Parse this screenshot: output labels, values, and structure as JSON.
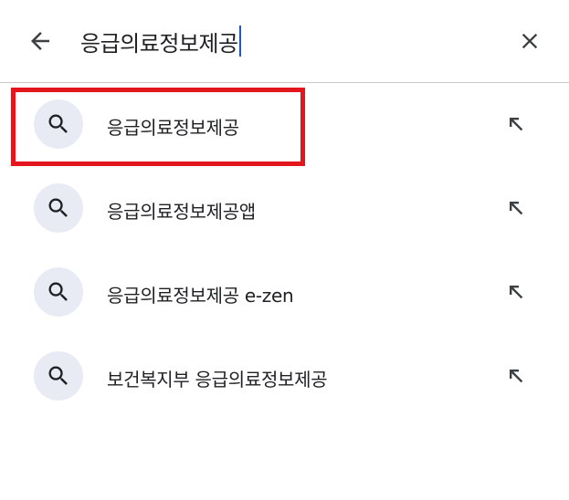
{
  "search": {
    "query": "응급의료정보제공",
    "back_icon": "arrow-left-icon",
    "clear_icon": "close-icon"
  },
  "suggestions": [
    {
      "text": "응급의료정보제공",
      "icon": "search-icon",
      "fill_icon": "arrow-up-left-icon"
    },
    {
      "text": "응급의료정보제공앱",
      "icon": "search-icon",
      "fill_icon": "arrow-up-left-icon"
    },
    {
      "text": "응급의료정보제공 e-zen",
      "icon": "search-icon",
      "fill_icon": "arrow-up-left-icon"
    },
    {
      "text": "보건복지부 응급의료정보제공",
      "icon": "search-icon",
      "fill_icon": "arrow-up-left-icon"
    }
  ],
  "colors": {
    "highlight": "#e3161e",
    "caret": "#1a56d6",
    "icon_bg": "#e8ebf3"
  }
}
